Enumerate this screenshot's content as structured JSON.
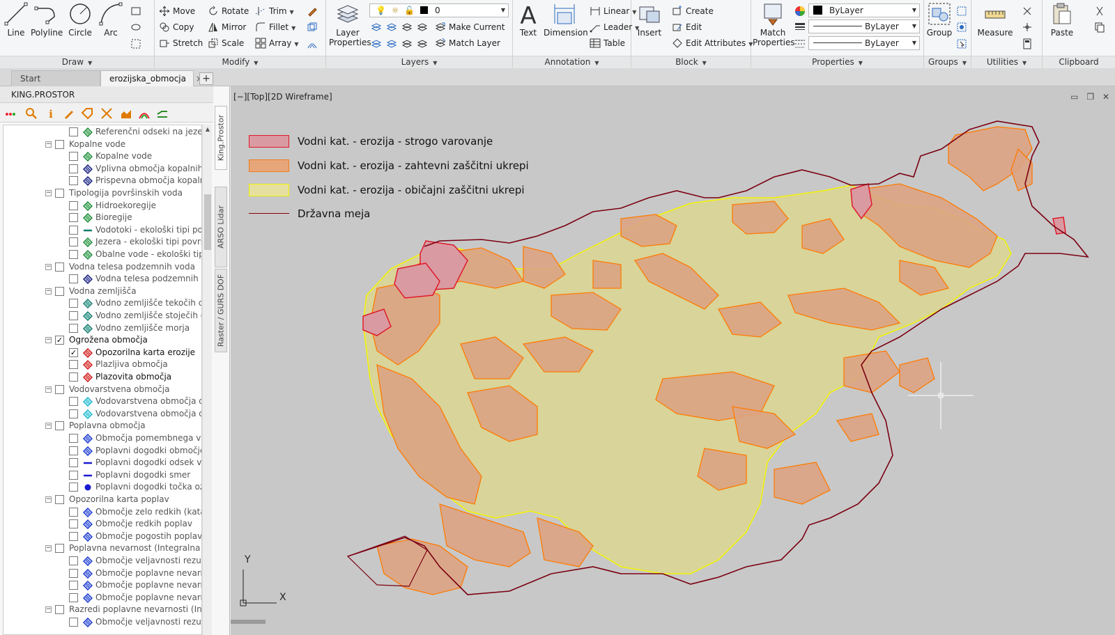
{
  "ribbon": {
    "draw": {
      "title": "Draw",
      "line": "Line",
      "polyline": "Polyline",
      "circle": "Circle",
      "arc": "Arc"
    },
    "modify": {
      "title": "Modify",
      "move": "Move",
      "rotate": "Rotate",
      "trim": "Trim",
      "copy": "Copy",
      "mirror": "Mirror",
      "fillet": "Fillet",
      "stretch": "Stretch",
      "scale": "Scale",
      "array": "Array"
    },
    "layers": {
      "title": "Layers",
      "layer_properties": "Layer Properties",
      "layer_value": "0",
      "make_current": "Make Current",
      "match_layer": "Match Layer"
    },
    "annotation": {
      "title": "Annotation",
      "text": "Text",
      "dimension": "Dimension",
      "linear": "Linear",
      "leader": "Leader",
      "table": "Table"
    },
    "block": {
      "title": "Block",
      "insert": "Insert",
      "create": "Create",
      "edit": "Edit",
      "edit_attributes": "Edit Attributes"
    },
    "properties": {
      "title": "Properties",
      "match_properties": "Match Properties",
      "color": "ByLayer",
      "linetype": "ByLayer",
      "lineweight": "ByLayer"
    },
    "groups": {
      "title": "Groups",
      "group": "Group"
    },
    "utilities": {
      "title": "Utilities",
      "measure": "Measure"
    },
    "clipboard": {
      "title": "Clipboard",
      "paste": "Paste"
    }
  },
  "tabs": [
    {
      "label": "Start"
    },
    {
      "label": "erozijska_obmocja",
      "close": "×"
    }
  ],
  "tab_plus": "+",
  "palette": {
    "title": "KING.PROSTOR",
    "vtabs": [
      "King.Prostor",
      "ARSO Lidar",
      "Raster / GURS DOF"
    ],
    "tree": [
      {
        "level": 2,
        "label": "Referenčni odseki na jezerih",
        "icon": "hatch-green",
        "checked": false,
        "dark": false
      },
      {
        "level": 1,
        "label": "Kopalne vode",
        "expander": "−",
        "checked": false,
        "dark": false
      },
      {
        "level": 2,
        "label": "Kopalne vode",
        "icon": "hatch-green",
        "checked": false,
        "dark": false
      },
      {
        "level": 2,
        "label": "Vplivna območja kopalnih vo",
        "icon": "hatch-navy",
        "checked": false,
        "dark": false
      },
      {
        "level": 2,
        "label": "Prispevna območja kopalnih",
        "icon": "hatch-navy",
        "checked": false,
        "dark": false
      },
      {
        "level": 1,
        "label": "Tipologija površinskih voda",
        "expander": "−",
        "checked": false,
        "dark": false
      },
      {
        "level": 2,
        "label": "Hidroekoregije",
        "icon": "hatch-green",
        "checked": false,
        "dark": false
      },
      {
        "level": 2,
        "label": "Bioregije",
        "icon": "hatch-green",
        "checked": false,
        "dark": false
      },
      {
        "level": 2,
        "label": "Vodotoki - ekološki tipi površ",
        "icon": "line-teal",
        "checked": false,
        "dark": false
      },
      {
        "level": 2,
        "label": "Jezera - ekološki tipi površins",
        "icon": "hatch-green",
        "checked": false,
        "dark": false
      },
      {
        "level": 2,
        "label": "Obalne vode - ekološki tipi p",
        "icon": "hatch-green",
        "checked": false,
        "dark": false
      },
      {
        "level": 1,
        "label": "Vodna telesa podzemnih voda",
        "expander": "−",
        "checked": false,
        "dark": false
      },
      {
        "level": 2,
        "label": "Vodna telesa podzemnih vod",
        "icon": "hatch-navy",
        "checked": false,
        "dark": false
      },
      {
        "level": 1,
        "label": "Vodna zemljišča",
        "expander": "−",
        "checked": false,
        "dark": false
      },
      {
        "level": 2,
        "label": "Vodno zemljišče tekočih celin",
        "icon": "hatch-teal",
        "checked": false,
        "dark": false
      },
      {
        "level": 2,
        "label": "Vodno zemljišče stoječih celin",
        "icon": "hatch-teal",
        "checked": false,
        "dark": false
      },
      {
        "level": 2,
        "label": "Vodno zemljišče morja",
        "icon": "hatch-teal",
        "checked": false,
        "dark": false
      },
      {
        "level": 1,
        "label": "Ogrožena območja",
        "expander": "−",
        "checked": true,
        "dark": true
      },
      {
        "level": 2,
        "label": "Opozorilna karta erozije",
        "icon": "hatch-red",
        "checked": true,
        "dark": true
      },
      {
        "level": 2,
        "label": "Plazljiva območja",
        "icon": "hatch-red",
        "checked": false,
        "dark": false
      },
      {
        "level": 2,
        "label": "Plazovita območja",
        "icon": "hatch-red",
        "checked": false,
        "dark": true
      },
      {
        "level": 1,
        "label": "Vodovarstvena območja",
        "expander": "−",
        "checked": false,
        "dark": false
      },
      {
        "level": 2,
        "label": "Vodovarstvena območja dolo",
        "icon": "hatch-cyan",
        "checked": false,
        "dark": false
      },
      {
        "level": 2,
        "label": "Vodovarstvena območja dolo",
        "icon": "hatch-cyan",
        "checked": false,
        "dark": false
      },
      {
        "level": 1,
        "label": "Poplavna območja",
        "expander": "−",
        "checked": false,
        "dark": false
      },
      {
        "level": 2,
        "label": "Območja pomembnega vpliv",
        "icon": "hatch-blue",
        "checked": false,
        "dark": false
      },
      {
        "level": 2,
        "label": "Poplavni dogodki območje",
        "icon": "hatch-blue",
        "checked": false,
        "dark": false
      },
      {
        "level": 2,
        "label": "Poplavni dogodki odsek vod",
        "icon": "line-blue",
        "checked": false,
        "dark": false
      },
      {
        "level": 2,
        "label": "Poplavni dogodki smer",
        "icon": "line-blue",
        "checked": false,
        "dark": false
      },
      {
        "level": 2,
        "label": "Poplavni dogodki točka oz. m",
        "icon": "dot-blue",
        "checked": false,
        "dark": false
      },
      {
        "level": 1,
        "label": "Opozorilna karta poplav",
        "expander": "−",
        "checked": false,
        "dark": false
      },
      {
        "level": 2,
        "label": "Območje zelo redkih (katastr",
        "icon": "hatch-blue",
        "checked": false,
        "dark": false
      },
      {
        "level": 2,
        "label": "Območje redkih poplav",
        "icon": "hatch-blue",
        "checked": false,
        "dark": false
      },
      {
        "level": 2,
        "label": "Območje pogostih poplav",
        "icon": "hatch-blue",
        "checked": false,
        "dark": false
      },
      {
        "level": 1,
        "label": "Poplavna nevarnost (Integralna k",
        "expander": "−",
        "checked": false,
        "dark": false
      },
      {
        "level": 2,
        "label": "Območje veljavnosti rezultat",
        "icon": "hatch-blue",
        "checked": false,
        "dark": false
      },
      {
        "level": 2,
        "label": "Območje poplavne nevarnost",
        "icon": "hatch-blue",
        "checked": false,
        "dark": false
      },
      {
        "level": 2,
        "label": "Območje poplavne nevarnos",
        "icon": "hatch-blue",
        "checked": false,
        "dark": false
      },
      {
        "level": 2,
        "label": "Območje poplavne nevarnos",
        "icon": "hatch-blue",
        "checked": false,
        "dark": false
      },
      {
        "level": 1,
        "label": "Razredi poplavne nevarnosti (Inte",
        "expander": "−",
        "checked": false,
        "dark": false
      },
      {
        "level": 2,
        "label": "Območje veljavnosti rezultat",
        "icon": "hatch-blue",
        "checked": false,
        "dark": false
      }
    ]
  },
  "viewport": {
    "label": "[−][Top][2D Wireframe]",
    "controls": [
      "▭",
      "❐",
      "✕"
    ],
    "axis_x": "X",
    "axis_y": "Y"
  },
  "legend": [
    {
      "label": "Vodni kat. - erozija - strogo varovanje",
      "fill": "#d9a0a4",
      "stroke": "#e0202a"
    },
    {
      "label": "Vodni kat. - erozija - zahtevni zaščitni ukrepi",
      "fill": "#e6a67a",
      "stroke": "#f07a1a"
    },
    {
      "label": "Vodni kat. - erozija - običajni zaščitni ukrepi",
      "fill": "#e6e0a0",
      "stroke": "#f0f000"
    },
    {
      "label": "Državna meja",
      "fill": "",
      "stroke": "#8b0000"
    }
  ],
  "colors": {
    "strict": "#d99aa2",
    "strict_stroke": "#e01a2a",
    "demanding": "#dba383",
    "demanding_stroke": "#ff7a00",
    "normal": "#d8d49a",
    "normal_stroke": "#f5f500",
    "border": "#7a0010"
  }
}
